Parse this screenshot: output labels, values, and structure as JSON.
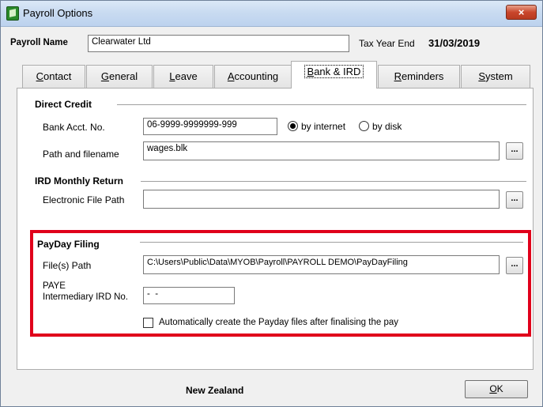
{
  "window": {
    "title": "Payroll Options",
    "close_glyph": "×"
  },
  "header": {
    "payroll_name_label": "Payroll Name",
    "payroll_name_value": "Clearwater Ltd",
    "tax_year_end_label": "Tax Year End",
    "tax_year_end_value": "31/03/2019"
  },
  "tabs": [
    {
      "label": "Contact",
      "mnemonic": "C",
      "rest": "ontact",
      "active": false
    },
    {
      "label": "General",
      "mnemonic": "G",
      "rest": "eneral",
      "active": false
    },
    {
      "label": "Leave",
      "mnemonic": "L",
      "rest": "eave",
      "active": false
    },
    {
      "label": "Accounting",
      "mnemonic": "A",
      "rest": "ccounting",
      "active": false
    },
    {
      "label": "Bank & IRD",
      "mnemonic": "B",
      "rest": "ank & IRD",
      "active": true
    },
    {
      "label": "Reminders",
      "mnemonic": "R",
      "rest": "eminders",
      "active": false
    },
    {
      "label": "System",
      "mnemonic": "S",
      "rest": "ystem",
      "active": false
    }
  ],
  "direct_credit": {
    "heading": "Direct Credit",
    "bank_acct_label": "Bank Acct. No.",
    "bank_acct_value": "06-9999-9999999-999",
    "radio_internet_label": "by internet",
    "radio_disk_label": "by disk",
    "selected": "by internet",
    "path_label": "Path and filename",
    "path_value": "wages.blk",
    "browse_label": "..."
  },
  "ird_monthly_return": {
    "heading": "IRD Monthly Return",
    "file_path_label": "Electronic File Path",
    "file_path_value": "",
    "browse_label": "..."
  },
  "payday_filing": {
    "heading": "PayDay Filing",
    "files_path_label": "File(s) Path",
    "files_path_value": "C:\\Users\\Public\\Data\\MYOB\\Payroll\\PAYROLL DEMO\\PayDayFiling",
    "browse_label": "...",
    "paye_label_line1": "PAYE",
    "paye_label_line2": "Intermediary IRD No.",
    "paye_value": "-  -",
    "auto_create_label": "Automatically create the Payday files after finalising the pay",
    "auto_create_checked": false
  },
  "footer": {
    "country": "New Zealand",
    "ok_mnemonic": "O",
    "ok_rest": "K"
  },
  "colors": {
    "highlight": "#e0001b",
    "close_button": "#c9462c"
  }
}
